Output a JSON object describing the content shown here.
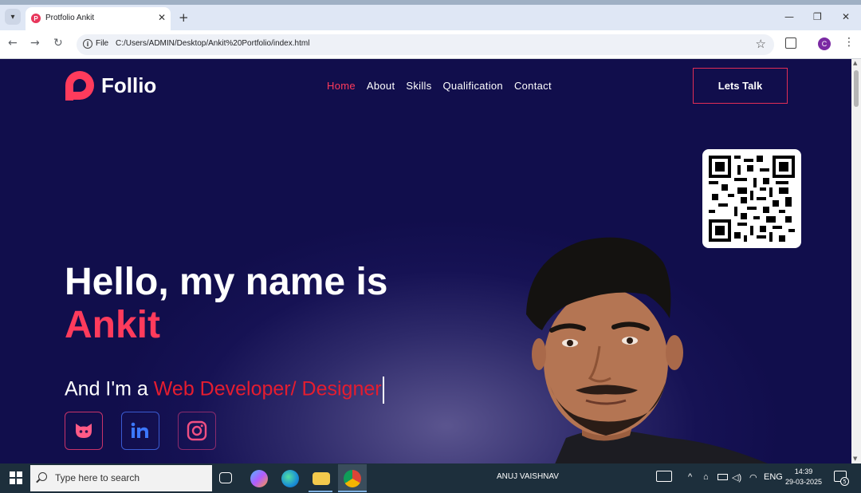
{
  "browser": {
    "tab_title": "Protfolio Ankit",
    "tab_close": "✕",
    "new_tab": "+",
    "file_label": "File",
    "url": "C:/Users/ADMIN/Desktop/Ankit%20Portfolio/index.html",
    "profile_initial": "C",
    "window_minimize": "—",
    "window_restore": "❐",
    "window_close": "✕"
  },
  "site": {
    "logo_text": "Follio",
    "nav": [
      {
        "label": "Home",
        "active": true
      },
      {
        "label": "About"
      },
      {
        "label": "Skills"
      },
      {
        "label": "Qualification"
      },
      {
        "label": "Contact"
      }
    ],
    "cta_label": "Lets Talk",
    "hero_line1": "Hello, my name is",
    "hero_name": "Ankit",
    "role_prefix": "And I'm a ",
    "role_highlight": "Web Developer/ Designer",
    "socials": [
      {
        "icon": "github-icon"
      },
      {
        "icon": "linkedin-icon"
      },
      {
        "icon": "instagram-icon"
      }
    ],
    "colors": {
      "accent": "#ff3b5c",
      "background": "#110e4c",
      "role_highlight": "#e51d2f"
    }
  },
  "taskbar": {
    "search_placeholder": "Type here to search",
    "center_label": "ANUJ VAISHNAV",
    "language": "ENG",
    "time": "14:39",
    "date": "29-03-2025",
    "notification_count": "5"
  }
}
